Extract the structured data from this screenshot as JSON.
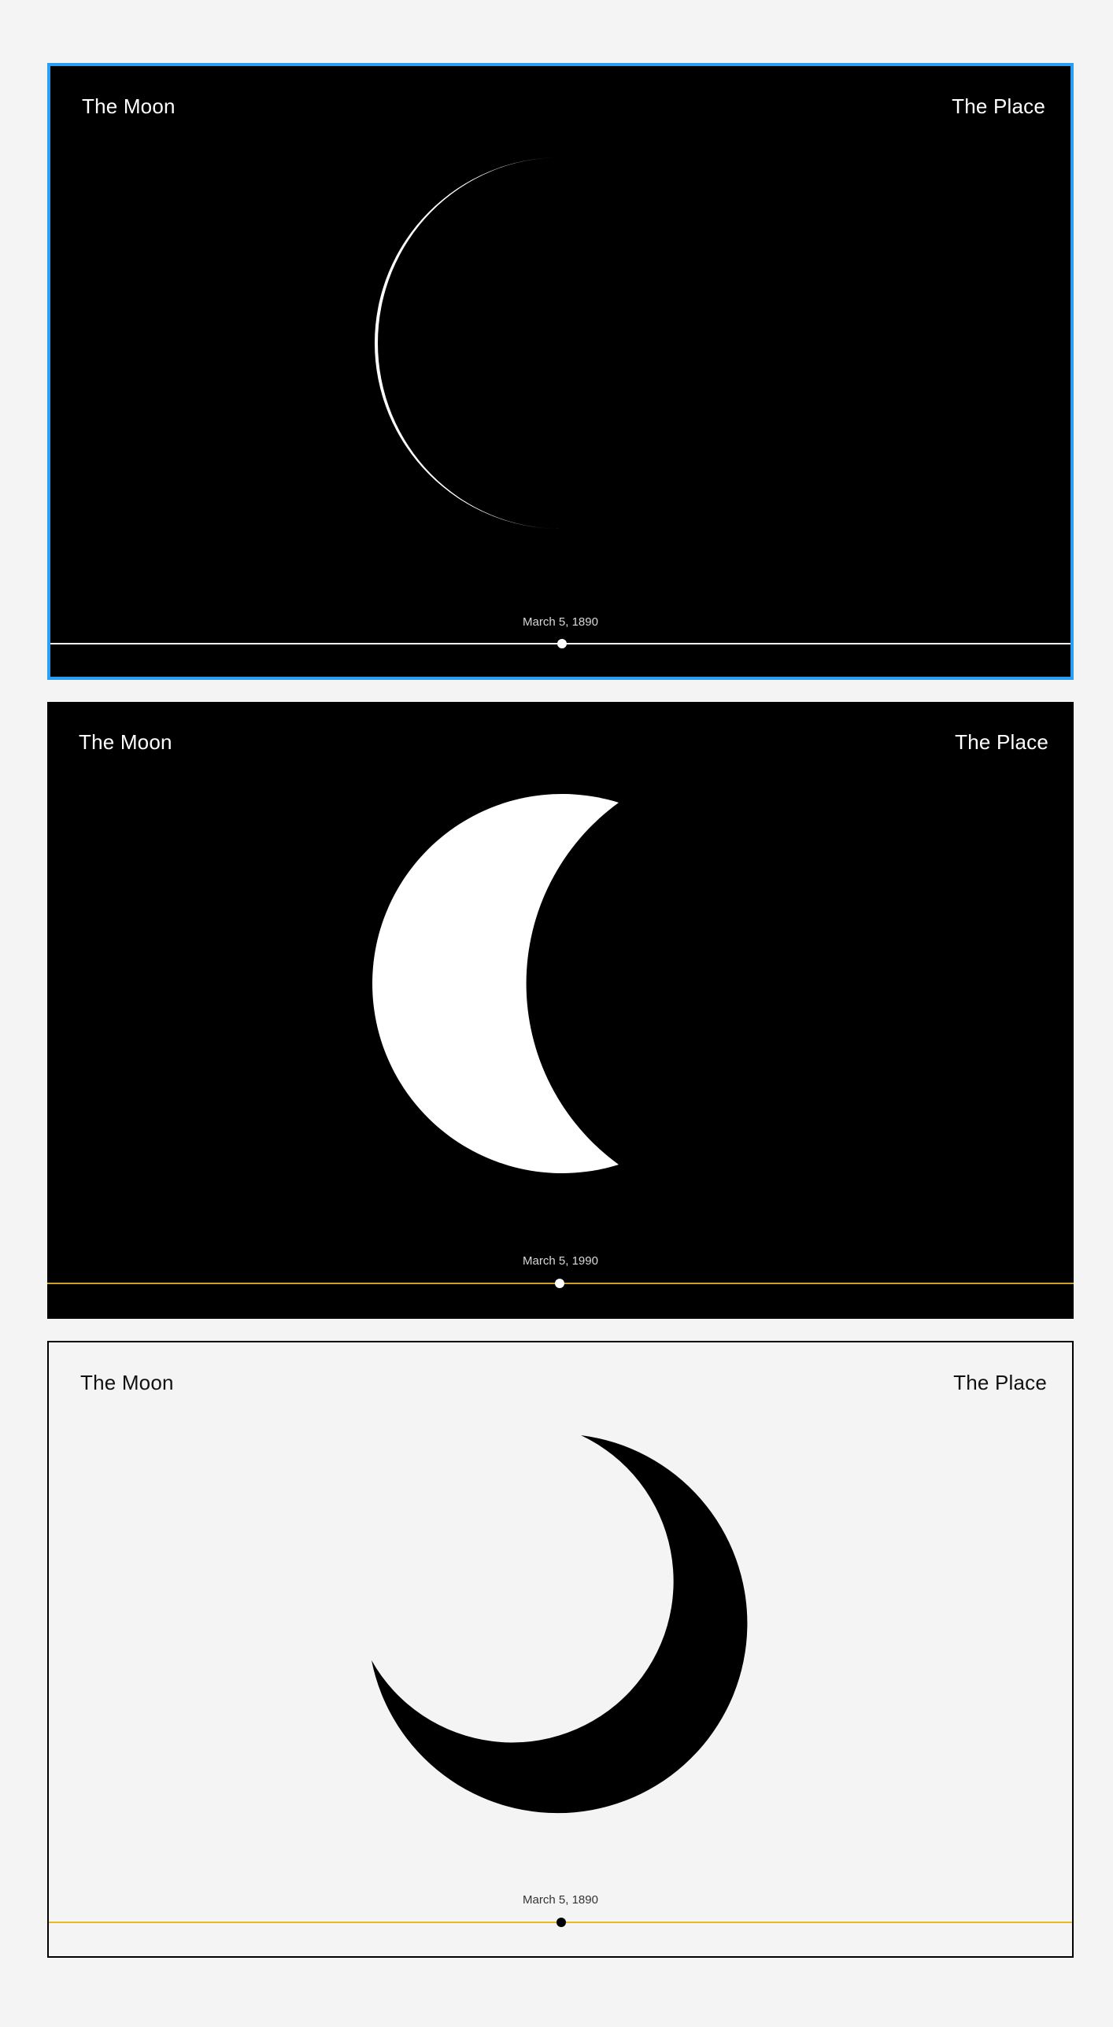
{
  "cards": [
    {
      "variant": "dark",
      "selected": true,
      "title": "The Moon",
      "place": "The Place",
      "date": "March 5, 1890",
      "accent_color": "#2a9df4",
      "track_color": "#ffffff",
      "illumination": 0.01
    },
    {
      "variant": "dark",
      "selected": false,
      "title": "The Moon",
      "place": "The Place",
      "date": "March 5, 1990",
      "track_color": "#c9a227",
      "illumination": 0.3
    },
    {
      "variant": "light",
      "selected": false,
      "title": "The Moon",
      "place": "The Place",
      "date": "March 5, 1890",
      "track_color": "#e8b820",
      "illumination": 0.25
    }
  ]
}
